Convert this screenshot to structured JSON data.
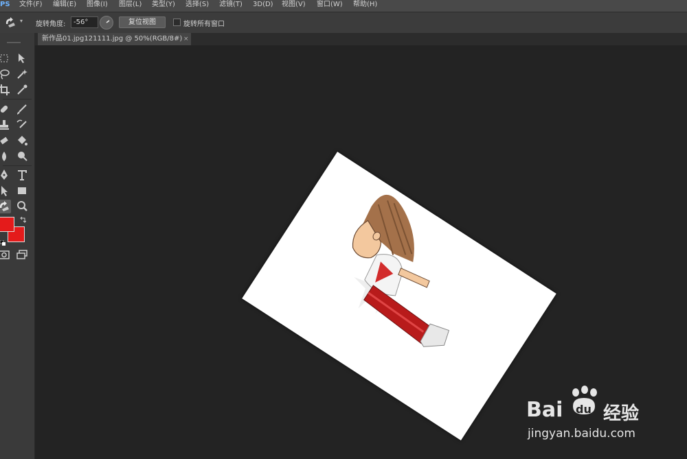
{
  "menubar": {
    "logo": "PS",
    "items": [
      "文件(F)",
      "编辑(E)",
      "图像(I)",
      "图层(L)",
      "类型(Y)",
      "选择(S)",
      "滤镜(T)",
      "3D(D)",
      "视图(V)",
      "窗口(W)",
      "帮助(H)"
    ]
  },
  "options": {
    "tool_icon": "rotate-view-icon",
    "angle_label": "旋转角度:",
    "angle_value": "-56°",
    "reset_label": "复位视图",
    "rotate_all_label": "旋转所有窗口",
    "rotate_all_checked": false
  },
  "document": {
    "tab_label": "新作品01.jpg121111.jpg @ 50%(RGB/8#)",
    "close_glyph": "×",
    "rotation_degrees": -56
  },
  "toolbox": {
    "tools": [
      "marquee-icon",
      "move-icon",
      "lasso-icon",
      "magic-wand-icon",
      "crop-icon",
      "eyedropper-icon",
      "healing-brush-icon",
      "brush-icon",
      "clone-stamp-icon",
      "history-brush-icon",
      "eraser-icon",
      "paint-bucket-icon",
      "blur-icon",
      "dodge-icon",
      "pen-icon",
      "type-icon",
      "path-select-icon",
      "rectangle-icon",
      "rotate-view-icon",
      "zoom-icon"
    ],
    "foreground_color": "#e41b1b",
    "background_color": "#e41b1b"
  },
  "watermark": {
    "brand": "Bai",
    "brand_suffix": "du",
    "product": "经验",
    "url": "jingyan.baidu.com"
  }
}
